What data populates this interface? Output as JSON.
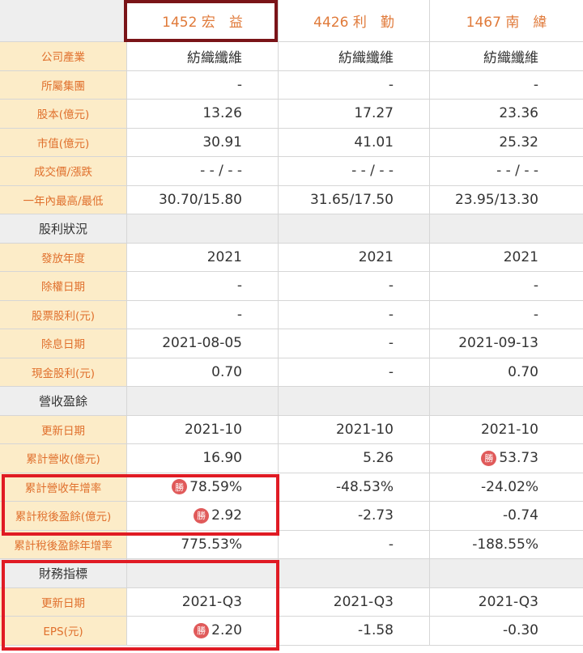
{
  "headers": [
    "1452 宏　益",
    "4426 利　勤",
    "1467 南　緯"
  ],
  "badge_text": "勝",
  "rows": [
    {
      "type": "data",
      "label": "公司產業",
      "values": [
        "紡織纖維",
        "紡織纖維",
        "紡織纖維"
      ]
    },
    {
      "type": "data",
      "label": "所屬集團",
      "values": [
        "-",
        "-",
        "-"
      ]
    },
    {
      "type": "data",
      "label": "股本(億元)",
      "values": [
        "13.26",
        "17.27",
        "23.36"
      ]
    },
    {
      "type": "data",
      "label": "市值(億元)",
      "values": [
        "30.91",
        "41.01",
        "25.32"
      ]
    },
    {
      "type": "data",
      "label": "成交價/漲跌",
      "values": [
        "- - / - -",
        "- - / - -",
        "- - / - -"
      ]
    },
    {
      "type": "data",
      "label": "一年內最高/最低",
      "values": [
        "30.70/15.80",
        "31.65/17.50",
        "23.95/13.30"
      ]
    },
    {
      "type": "section",
      "label": "股利狀況"
    },
    {
      "type": "data",
      "label": "發放年度",
      "values": [
        "2021",
        "2021",
        "2021"
      ]
    },
    {
      "type": "data",
      "label": "除權日期",
      "values": [
        "-",
        "-",
        "-"
      ]
    },
    {
      "type": "data",
      "label": "股票股利(元)",
      "values": [
        "-",
        "-",
        "-"
      ]
    },
    {
      "type": "data",
      "label": "除息日期",
      "values": [
        "2021-08-05",
        "-",
        "2021-09-13"
      ]
    },
    {
      "type": "data",
      "label": "現金股利(元)",
      "values": [
        "0.70",
        "-",
        "0.70"
      ]
    },
    {
      "type": "section",
      "label": "營收盈餘"
    },
    {
      "type": "data",
      "label": "更新日期",
      "values": [
        "2021-10",
        "2021-10",
        "2021-10"
      ]
    },
    {
      "type": "data",
      "label": "累計營收(億元)",
      "values": [
        "16.90",
        "5.26",
        "53.73"
      ],
      "wins": [
        false,
        false,
        true
      ]
    },
    {
      "type": "data",
      "label": "累計營收年增率",
      "values": [
        "78.59%",
        "-48.53%",
        "-24.02%"
      ],
      "wins": [
        true,
        false,
        false
      ]
    },
    {
      "type": "data",
      "label": "累計稅後盈餘(億元)",
      "values": [
        "2.92",
        "-2.73",
        "-0.74"
      ],
      "wins": [
        true,
        false,
        false
      ]
    },
    {
      "type": "data",
      "label": "累計稅後盈餘年增率",
      "values": [
        "775.53%",
        "-",
        "-188.55%"
      ]
    },
    {
      "type": "section",
      "label": "財務指標"
    },
    {
      "type": "data",
      "label": "更新日期",
      "values": [
        "2021-Q3",
        "2021-Q3",
        "2021-Q3"
      ]
    },
    {
      "type": "data",
      "label": "EPS(元)",
      "values": [
        "2.20",
        "-1.58",
        "-0.30"
      ],
      "wins": [
        true,
        false,
        false
      ]
    }
  ]
}
